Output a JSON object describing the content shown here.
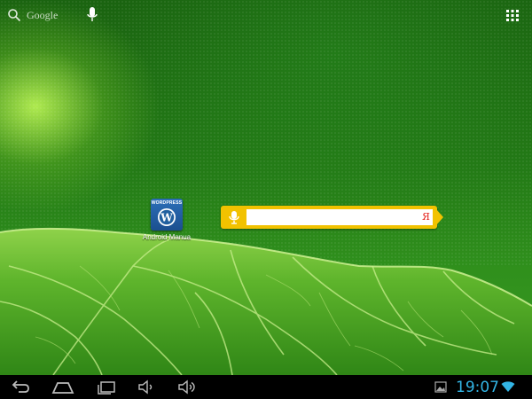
{
  "top_bar": {
    "search_label": "Google",
    "search_icon": "search-icon",
    "voice_icon": "microphone-icon",
    "apps_icon": "all-apps-grid-icon"
  },
  "desktop": {
    "app_icon": {
      "badge_text": "WORDPRESS",
      "glyph": "W",
      "label": "Android Manua"
    }
  },
  "yandex_widget": {
    "mic_icon": "microphone-icon",
    "input_value": "",
    "logo": "Я",
    "accent_color": "#f2c200"
  },
  "system_bar": {
    "back_icon": "back-icon",
    "home_icon": "home-icon",
    "recents_icon": "recent-apps-icon",
    "volume_down_icon": "volume-down-icon",
    "volume_up_icon": "volume-up-icon",
    "screenshot_icon": "image-icon",
    "time": "19:07",
    "wifi_icon": "wifi-icon",
    "clock_color": "#33b5e5"
  }
}
